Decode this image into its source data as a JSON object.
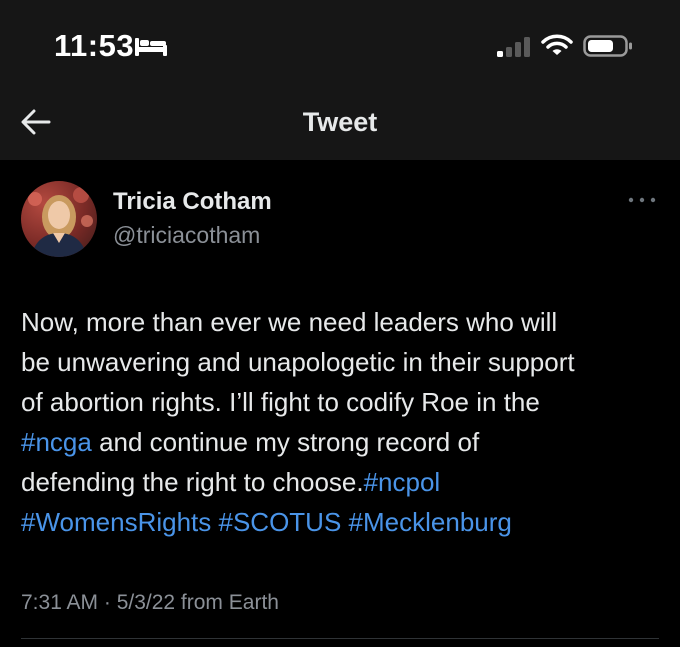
{
  "status_bar": {
    "time": "11:53",
    "icons": [
      "bed-icon",
      "cellular-signal-icon",
      "wifi-icon",
      "battery-icon"
    ]
  },
  "header": {
    "back_icon": "back-arrow-icon",
    "title": "Tweet"
  },
  "tweet": {
    "author": {
      "name": "Tricia Cotham",
      "handle": "@triciacotham",
      "avatar_icon": "avatar"
    },
    "more_icon": "more-options-icon",
    "body": {
      "line1": "Now, more than ever we need leaders who will",
      "line2": "be unwavering and unapologetic in their support",
      "line3": "of abortion rights. I’ll fight to codify Roe in the",
      "hashtag_ncga": "#ncga",
      "line4_rest": " and continue my strong record of",
      "line5": "defending the right to choose.",
      "hashtag_ncpol": "#ncpol",
      "hashtag_womensrights": "#WomensRights",
      "hashtag_scotus": "#SCOTUS",
      "hashtag_mecklenburg": "#Mecklenburg"
    },
    "meta": "7:31 AM · 5/3/22 from Earth"
  },
  "colors": {
    "background": "#000000",
    "header_bg": "#161616",
    "text": "#e7e9ea",
    "secondary_text": "#8b9097",
    "hashtag": "#4a94e8",
    "divider": "#2f3336"
  }
}
